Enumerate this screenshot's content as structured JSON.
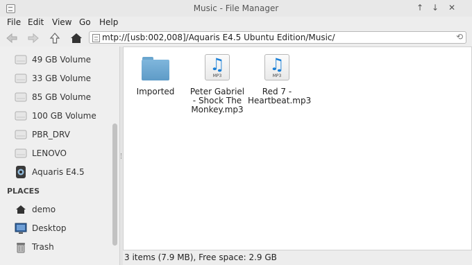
{
  "window": {
    "title": "Music - File Manager",
    "controls": [
      "up-arrow-icon",
      "down-arrow-icon",
      "close-icon"
    ]
  },
  "menu": [
    "File",
    "Edit",
    "View",
    "Go",
    "Help"
  ],
  "toolbar": {
    "buttons": [
      "back-icon",
      "forward-icon",
      "up-icon",
      "home-icon"
    ],
    "location": "mtp://[usb:002,008]/Aquaris E4.5 Ubuntu Edition/Music/"
  },
  "sidebar": {
    "devices": [
      {
        "label": "49 GB Volume",
        "icon": "drive-icon"
      },
      {
        "label": "33 GB Volume",
        "icon": "drive-icon"
      },
      {
        "label": "85 GB Volume",
        "icon": "drive-icon"
      },
      {
        "label": "100 GB Volume",
        "icon": "drive-icon"
      },
      {
        "label": "PBR_DRV",
        "icon": "drive-icon"
      },
      {
        "label": "LENOVO",
        "icon": "drive-icon"
      },
      {
        "label": "Aquaris E4.5",
        "icon": "phone-icon"
      }
    ],
    "places_heading": "PLACES",
    "places": [
      {
        "label": "demo",
        "icon": "home-icon"
      },
      {
        "label": "Desktop",
        "icon": "desktop-icon"
      },
      {
        "label": "Trash",
        "icon": "trash-icon"
      }
    ]
  },
  "files": [
    {
      "name": "Imported",
      "type": "folder"
    },
    {
      "name": "Peter Gabriel - Shock The Monkey.mp3",
      "type": "mp3"
    },
    {
      "name": "Red 7 - Heartbeat.mp3",
      "type": "mp3"
    }
  ],
  "mp3_tag": "MP3",
  "status": "3 items (7.9 MB), Free space: 2.9 GB",
  "colors": {
    "accent": "#1a7fd6",
    "folder": "#6aa6cf"
  }
}
